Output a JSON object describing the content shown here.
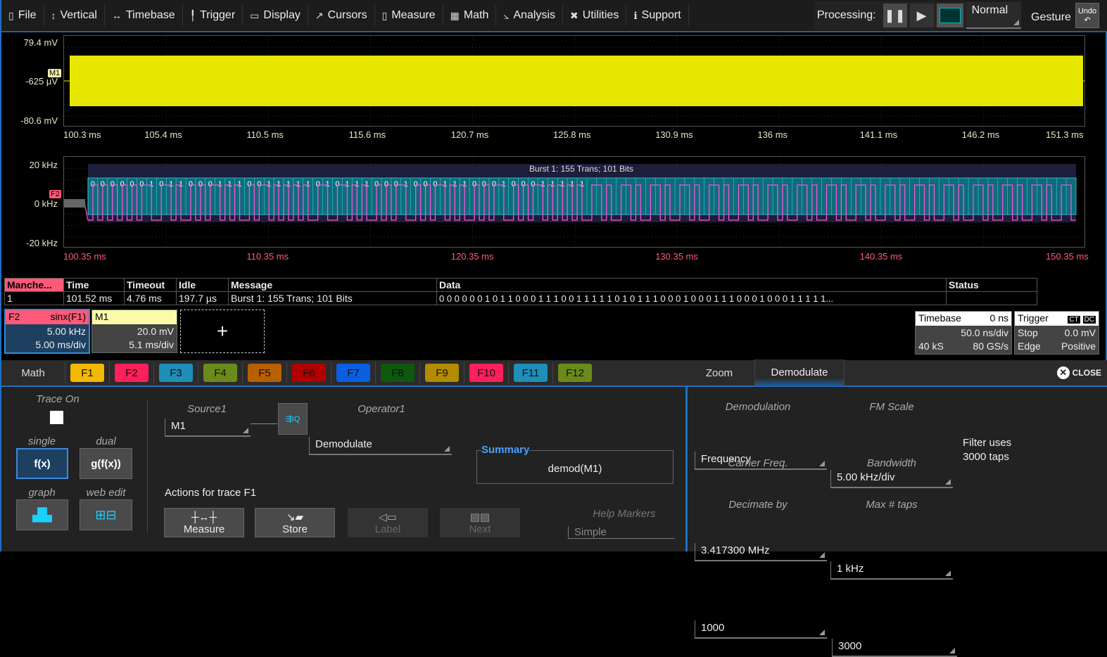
{
  "menu": [
    {
      "label": "File",
      "icon": "file-icon",
      "glyph": "▯"
    },
    {
      "label": "Vertical",
      "icon": "vertical-icon",
      "glyph": "↕"
    },
    {
      "label": "Timebase",
      "icon": "timebase-icon",
      "glyph": "↔"
    },
    {
      "label": "Trigger",
      "icon": "trigger-icon",
      "glyph": "╿"
    },
    {
      "label": "Display",
      "icon": "display-icon",
      "glyph": "▭"
    },
    {
      "label": "Cursors",
      "icon": "cursors-icon",
      "glyph": "↗"
    },
    {
      "label": "Measure",
      "icon": "measure-icon",
      "glyph": "▯"
    },
    {
      "label": "Math",
      "icon": "math-icon",
      "glyph": "▦"
    },
    {
      "label": "Analysis",
      "icon": "analysis-icon",
      "glyph": "⦣"
    },
    {
      "label": "Utilities",
      "icon": "utilities-icon",
      "glyph": "✖"
    },
    {
      "label": "Support",
      "icon": "support-icon",
      "glyph": "ℹ"
    }
  ],
  "processing": {
    "label": "Processing:",
    "mode": "Normal",
    "gesture": "Gesture",
    "undo": "Undo"
  },
  "grid1": {
    "trace": "M1",
    "y_top": "79.4 mV",
    "y_mid": "-625 µV",
    "y_bot": "-80.6 mV",
    "x_labels": [
      "100.3 ms",
      "105.4 ms",
      "110.5 ms",
      "115.6 ms",
      "120.7 ms",
      "125.8 ms",
      "130.9 ms",
      "136 ms",
      "141.1 ms",
      "146.2 ms",
      "151.3 ms"
    ],
    "color": "#e6e600"
  },
  "grid2": {
    "trace": "F2",
    "y_top": "20 kHz",
    "y_mid": "0 kHz",
    "y_bot": "-20 kHz",
    "x_labels": [
      "100.35 ms",
      "110.35 ms",
      "120.35 ms",
      "130.35 ms",
      "140.35 ms",
      "150.35 ms"
    ],
    "burst": "Burst 1: 155 Trans; 101 Bits",
    "color": "#ff4fd8"
  },
  "table": {
    "headers": [
      "Manche...",
      "Time",
      "Timeout",
      "Idle",
      "Message",
      "Data",
      "Status"
    ],
    "row": [
      "1",
      "101.52 ms",
      "4.76 ms",
      "197.7 µs",
      "Burst 1: 155 Trans; 101 Bits",
      "0 0 0 0 0 0 1 0 1 1 0 0 0 1 1 1 0 0 1 1 1 1 1 0 1 0 1 1 1 0 0 0 1 0 0 0 1 1 1 0 0 0 1 0 0 0 1 1 1 1 1...",
      ""
    ]
  },
  "bits": "000000101100011100111110101110001000111000100011111",
  "descriptors": {
    "f2": {
      "name": "F2",
      "func": "sinx(F1)",
      "v1": "5.00 kHz",
      "v2": "5.00 ms/div"
    },
    "m1": {
      "name": "M1",
      "v1": "20.0 mV",
      "v2": "5.1 ms/div"
    },
    "add": "+"
  },
  "timebase": {
    "title": "Timebase",
    "delay": "0 ns",
    "div": "50.0 ns/div",
    "samples": "40 kS",
    "rate": "80 GS/s"
  },
  "trigger": {
    "title": "Trigger",
    "ct": "CT",
    "dc": "DC",
    "mode": "Stop",
    "level": "0.0 mV",
    "type": "Edge",
    "slope": "Positive"
  },
  "tabs": {
    "math": "Math",
    "f": [
      {
        "l": "F1",
        "c": "#f5b800"
      },
      {
        "l": "F2",
        "c": "#ff1f5a"
      },
      {
        "l": "F3",
        "c": "#1e8fb8"
      },
      {
        "l": "F4",
        "c": "#6b8a1c"
      },
      {
        "l": "F5",
        "c": "#b85f00"
      },
      {
        "l": "F6",
        "c": "#b00000"
      },
      {
        "l": "F7",
        "c": "#0a5fe0"
      },
      {
        "l": "F8",
        "c": "#0d5a0d"
      },
      {
        "l": "F9",
        "c": "#b38b00"
      },
      {
        "l": "F10",
        "c": "#ff1f5a"
      },
      {
        "l": "F11",
        "c": "#1e8fb8"
      },
      {
        "l": "F12",
        "c": "#6b8a1c"
      }
    ],
    "zoom": "Zoom",
    "demod": "Demodulate",
    "close": "CLOSE"
  },
  "left": {
    "trace_on": "Trace On",
    "single": "single",
    "single_btn": "f(x)",
    "dual": "dual",
    "dual_btn": "g(f(x))",
    "graph": "graph",
    "web": "web edit"
  },
  "mid": {
    "source_label": "Source1",
    "source": "M1",
    "operator_label": "Operator1",
    "operator": "Demodulate",
    "summary_title": "Summary",
    "summary": "demod(M1)",
    "actions": "Actions for trace F1",
    "measure": "Measure",
    "store": "Store",
    "label": "Label",
    "next": "Next",
    "help_label": "Help Markers",
    "help": "Simple"
  },
  "right": {
    "demod_label": "Demodulation",
    "demod": "Frequency",
    "fm_label": "FM Scale",
    "fm": "5.00 kHz/div",
    "carrier_label": "Carrier Freq.",
    "carrier": "3.417300 MHz",
    "bw_label": "Bandwidth",
    "bw": "1 kHz",
    "dec_label": "Decimate by",
    "dec": "1000",
    "taps_label": "Max # taps",
    "taps": "3000",
    "note1": "Filter uses",
    "note2": "3000 taps"
  }
}
